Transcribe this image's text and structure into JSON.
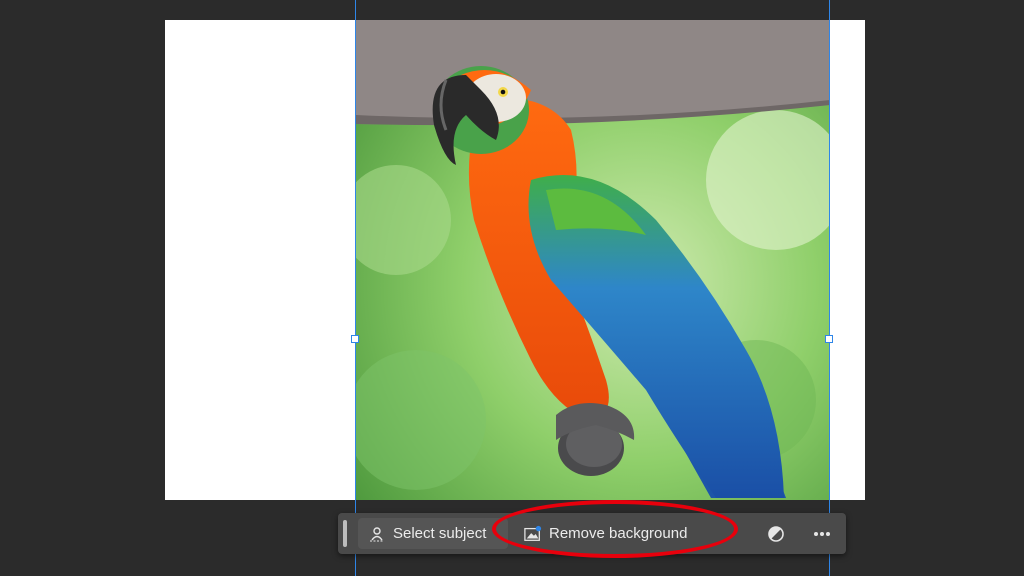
{
  "canvas": {
    "background": "#ffffff"
  },
  "photo": {
    "subject": "parrot-photo",
    "selection_color": "#2f86e8"
  },
  "contextual_taskbar": {
    "select_subject_label": "Select subject",
    "remove_background_label": "Remove background",
    "adjust_icon": "half-circle-icon",
    "more_icon": "ellipsis-icon"
  },
  "annotation": {
    "color": "#e8000c",
    "shape": "ellipse"
  }
}
